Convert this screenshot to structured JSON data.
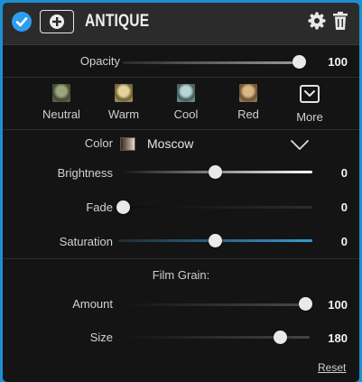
{
  "header": {
    "title": "ANTIQUE",
    "enabled": true
  },
  "opacity": {
    "label": "Opacity",
    "value": "100",
    "level": 1.0
  },
  "presets": [
    {
      "label": "Neutral",
      "tint": "#5e6b49"
    },
    {
      "label": "Warm",
      "tint": "#b7a46a"
    },
    {
      "label": "Cool",
      "tint": "#6d8f8e"
    },
    {
      "label": "Red",
      "tint": "#a58a5d"
    },
    {
      "label": "More",
      "icon": "chevron-box-icon"
    }
  ],
  "color": {
    "label": "Color",
    "value": "Moscow"
  },
  "brightness": {
    "label": "Brightness",
    "value": "0",
    "level": 0.5
  },
  "fade": {
    "label": "Fade",
    "value": "0",
    "level": 0.0
  },
  "saturation": {
    "label": "Saturation",
    "value": "0",
    "level": 0.5
  },
  "film_grain": {
    "title": "Film Grain:",
    "amount": {
      "label": "Amount",
      "value": "100",
      "level": 1.0
    },
    "size": {
      "label": "Size",
      "value": "180",
      "level": 0.85
    }
  },
  "reset_label": "Reset",
  "colors": {
    "accent": "#2f9df0",
    "panel_bg": "#141414",
    "frame": "#1f8fd3"
  }
}
